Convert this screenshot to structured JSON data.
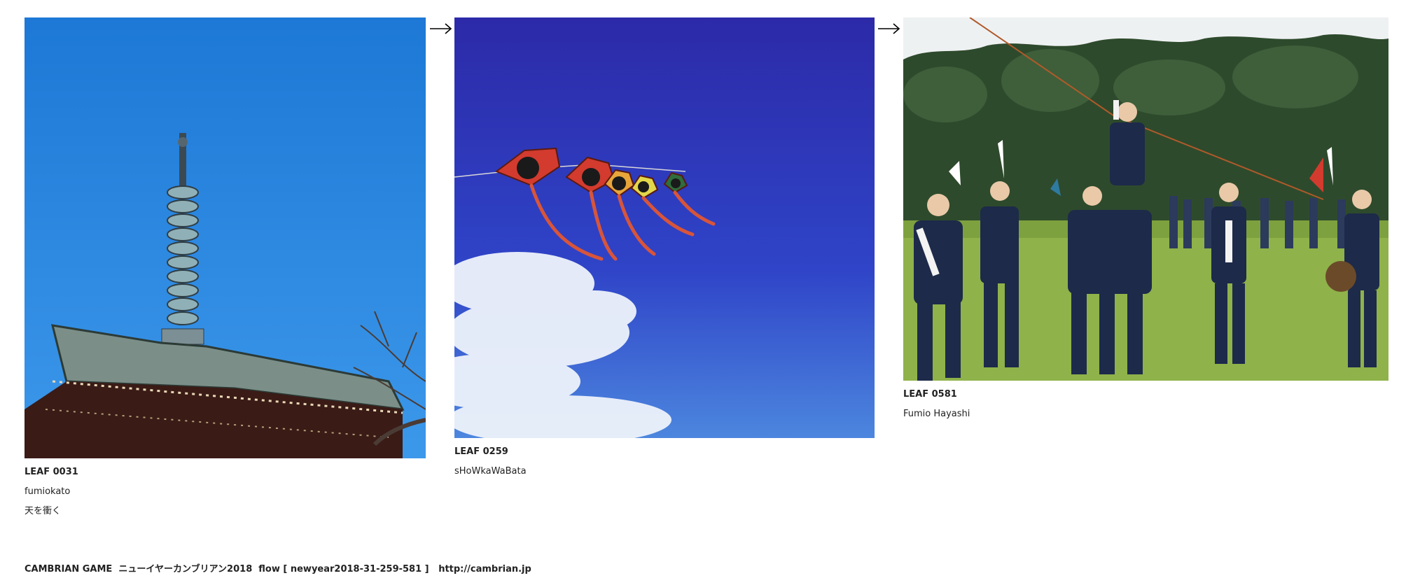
{
  "leaves": [
    {
      "id": "LEAF 0031",
      "author": "fumiokato",
      "title": "天を衝く"
    },
    {
      "id": "LEAF 0259",
      "author": "sHoWkaWaBata"
    },
    {
      "id": "LEAF 0581",
      "author": "Fumio Hayashi"
    }
  ],
  "flow_arrow": "→",
  "footer": {
    "text": "CAMBRIAN GAME  ニューイヤーカンブリアン2018  flow [ newyear2018-31-259-581 ]   http://cambrian.jp"
  },
  "colors": {
    "sky_light": "#1e7fd9",
    "sky_deep": "#2a2fb4",
    "grass": "#8fb24a",
    "trees": "#2e4a2c",
    "kite_red": "#d23b2e"
  },
  "icons": [
    "right-arrow-icon"
  ]
}
